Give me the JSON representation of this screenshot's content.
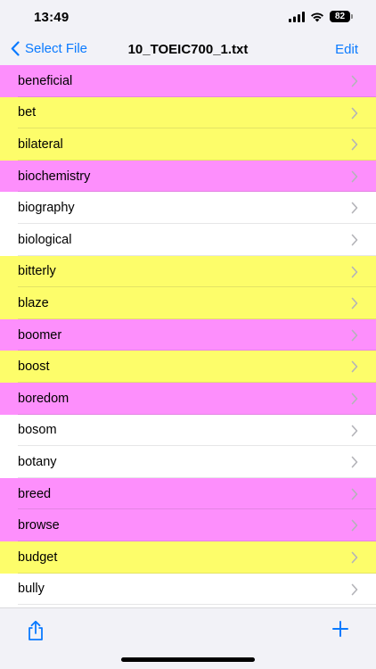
{
  "status": {
    "time": "13:49",
    "battery": "82",
    "icons": [
      "cellular-signal-icon",
      "wifi-icon",
      "battery-icon"
    ]
  },
  "nav": {
    "back_label": "Select File",
    "title": "10_TOEIC700_1.txt",
    "edit_label": "Edit",
    "back_icon": "chevron-left-icon"
  },
  "colors": {
    "accent": "#0a7aff",
    "pink": "#fd8ffc",
    "yellow": "#fdfd6a",
    "white": "#ffffff"
  },
  "words": [
    {
      "text": "beneficial",
      "color": "pink"
    },
    {
      "text": "bet",
      "color": "yellow"
    },
    {
      "text": "bilateral",
      "color": "yellow"
    },
    {
      "text": "biochemistry",
      "color": "pink"
    },
    {
      "text": "biography",
      "color": "white"
    },
    {
      "text": "biological",
      "color": "white"
    },
    {
      "text": "bitterly",
      "color": "yellow"
    },
    {
      "text": "blaze",
      "color": "yellow"
    },
    {
      "text": "boomer",
      "color": "pink"
    },
    {
      "text": "boost",
      "color": "yellow"
    },
    {
      "text": "boredom",
      "color": "pink"
    },
    {
      "text": "bosom",
      "color": "white"
    },
    {
      "text": "botany",
      "color": "white"
    },
    {
      "text": "breed",
      "color": "pink"
    },
    {
      "text": "browse",
      "color": "pink"
    },
    {
      "text": "budget",
      "color": "yellow"
    },
    {
      "text": "bully",
      "color": "white"
    }
  ],
  "toolbar": {
    "share_icon": "share-icon",
    "add_icon": "plus-icon"
  }
}
